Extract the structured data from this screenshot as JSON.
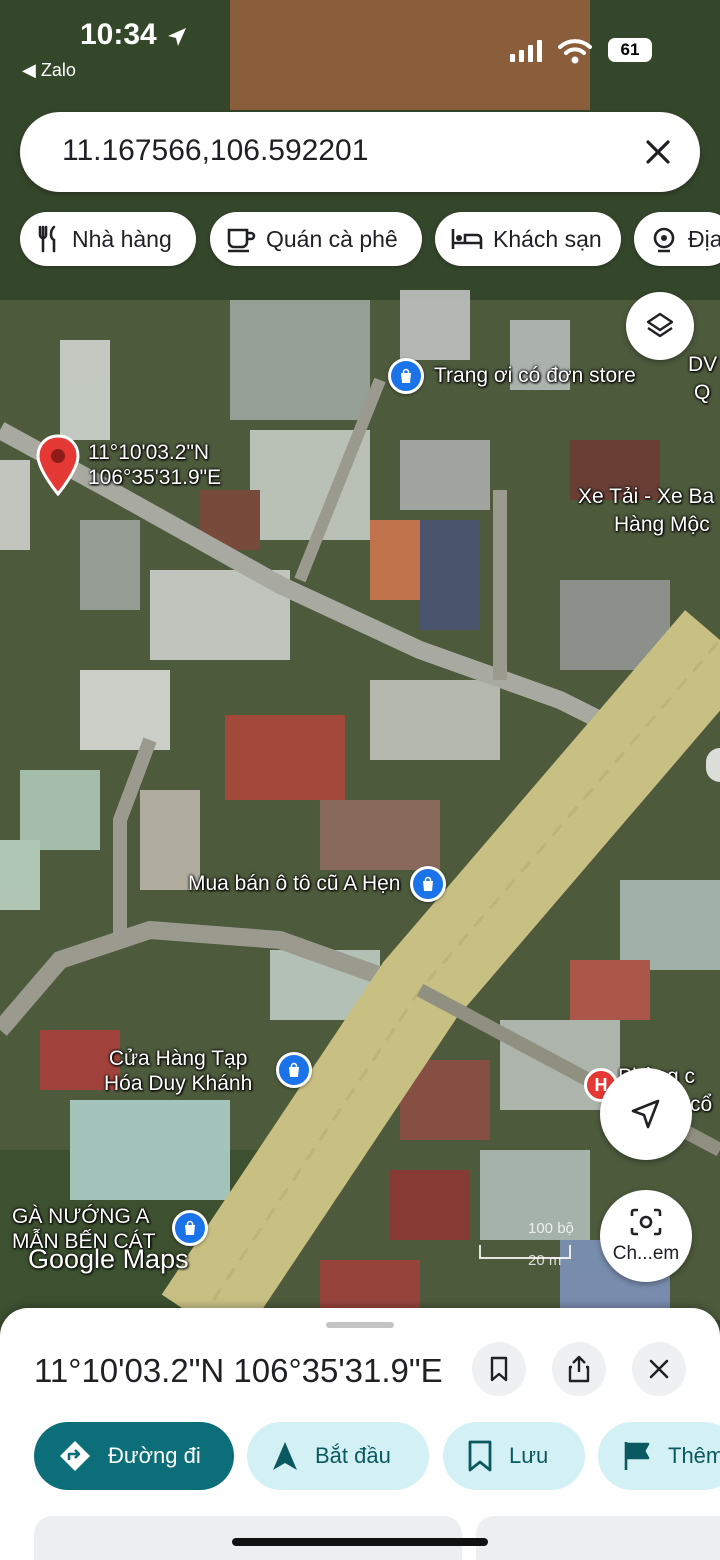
{
  "status_bar": {
    "time": "10:34",
    "back_app": "◀ Zalo",
    "battery": "61",
    "icons": [
      "location-arrow-icon",
      "signal-icon",
      "wifi-icon",
      "battery-icon"
    ]
  },
  "search": {
    "query": "11.167566,106.592201",
    "clear_icon": "close-icon"
  },
  "chips": [
    {
      "label": "Nhà hàng",
      "icon": "restaurant-icon"
    },
    {
      "label": "Quán cà phê",
      "icon": "coffee-icon"
    },
    {
      "label": "Khách sạn",
      "icon": "hotel-icon"
    },
    {
      "label": "Địa",
      "icon": "attraction-icon"
    }
  ],
  "map": {
    "pin_coords": {
      "lat": "11°10'03.2\"N",
      "lng": "106°35'31.9\"E"
    },
    "pois": [
      {
        "name": "Trang ơi có đơn store"
      },
      {
        "name": "Mua bán ô tô cũ A Hẹn"
      },
      {
        "name_line1": "Cửa Hàng Tạp",
        "name_line2": "Hóa Duy Khánh"
      },
      {
        "name_line1": "GÀ NƯỚNG A",
        "name_line2": "MẪN BẾN CÁT"
      }
    ],
    "edge_labels": {
      "dv": "DV",
      "q": "Q",
      "xe_tai": "Xe Tải - Xe Ba",
      "hang_moc": "Hàng Mộc",
      "phong": "Phòng c",
      "co": "cổ"
    },
    "scale": {
      "top": "100 bộ",
      "bottom": "20 m"
    },
    "watermark": "Google Maps",
    "lens_label": "Ch...em"
  },
  "sheet": {
    "title": "11°10'03.2\"N 106°35'31.9\"E",
    "actions": [
      {
        "label": "Đường đi",
        "icon": "directions-icon"
      },
      {
        "label": "Bắt đầu",
        "icon": "navigation-icon"
      },
      {
        "label": "Lưu",
        "icon": "bookmark-icon"
      },
      {
        "label": "Thêm",
        "icon": "flag-icon"
      }
    ]
  },
  "colors": {
    "primary": "#0b6e78",
    "secondary_bg": "#d3f1f5",
    "pin": "#e53935",
    "poi": "#1a73e8"
  }
}
